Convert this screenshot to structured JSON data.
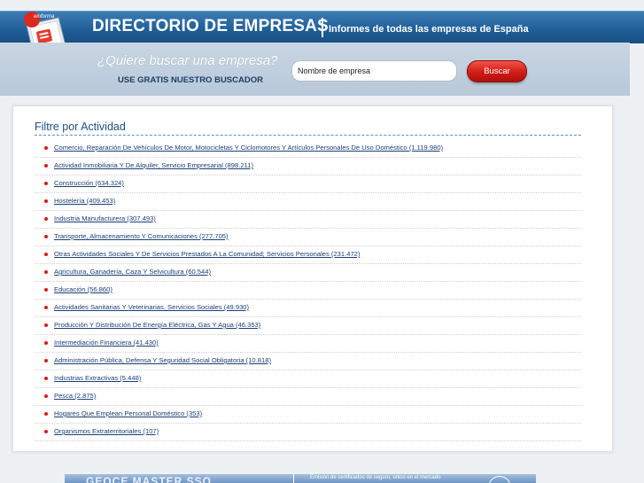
{
  "header": {
    "title": "DIRECTORIO DE EMPRESAS",
    "subtitle": "Informes de todas las empresas de España",
    "logo_text": "einforma"
  },
  "search": {
    "question": "¿Quiere buscar una empresa?",
    "subtext": "USE GRATIS NUESTRO BUSCADOR",
    "input_value": "Nombre de empresa",
    "button_label": "Buscar"
  },
  "panel": {
    "title": "Filtre por Actividad",
    "items": [
      {
        "label": "Comercio, Reparación De Vehículos De Motor, Motocicletas Y Ciclomotores Y Artículos Personales De Uso Doméstico (1.119.980)"
      },
      {
        "label": "Actividad Inmobiliaria Y De Alquiler, Servicio Empresarial (898.211)"
      },
      {
        "label": "Construcción (634.324)"
      },
      {
        "label": "Hostelería (409.453)"
      },
      {
        "label": "Industria Manufacturera (307.493)"
      },
      {
        "label": "Transporte, Almacenamiento Y Comunicaciones (277.705)"
      },
      {
        "label": "Otras Actividades Sociales Y De Servicios Prestados A La Comunidad; Servicios Personales (231.472)"
      },
      {
        "label": "Agricultura, Ganadería, Caza Y Selvicultura (60.544)"
      },
      {
        "label": "Educación (56.860)"
      },
      {
        "label": "Actividades Sanitarias Y Veterinarias, Servicios Sociales (49.930)"
      },
      {
        "label": "Producción Y Distribución De Energía Eléctrica, Gas Y Agua (46.353)"
      },
      {
        "label": "Intermediación Financiera (41.430)"
      },
      {
        "label": "Administración Pública, Defensa Y Seguridad Social Obligatoria (10.818)"
      },
      {
        "label": "Industrias Extractivas (5.448)"
      },
      {
        "label": "Pesca (2.875)"
      },
      {
        "label": "Hogares Que Emplean Personal Doméstico (353)"
      },
      {
        "label": "Organismos Extraterritoriales (107)"
      }
    ]
  },
  "banner": {
    "left_text": "GEOCE MASTER SSO",
    "right_text": "Emisión de certificados de seguro, único en el mercado"
  },
  "colors": {
    "header_blue": "#1e5d96",
    "title_blue": "#1c4e86",
    "link_blue": "#1a3f74",
    "bullet_red": "#d61a1a",
    "button_red": "#d01c14"
  }
}
